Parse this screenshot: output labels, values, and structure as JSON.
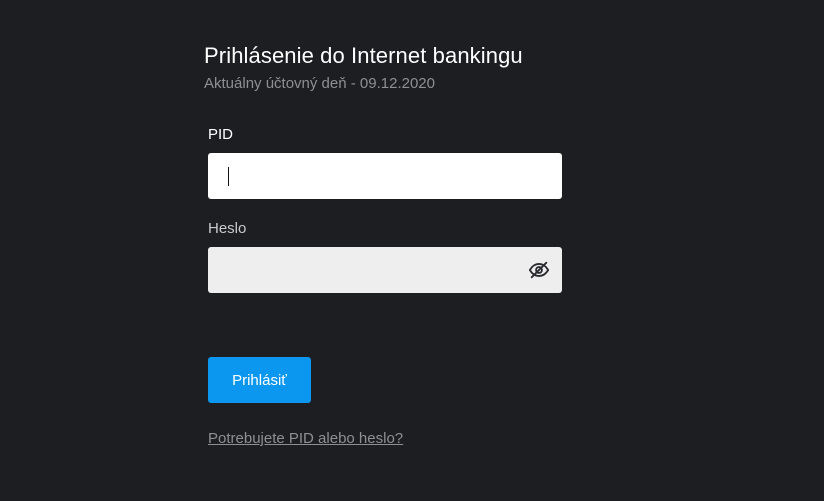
{
  "login": {
    "title": "Prihlásenie do Internet bankingu",
    "subtitle": "Aktuálny účtovný deň - 09.12.2020",
    "pid_label": "PID",
    "pid_value": "",
    "pid_placeholder": "",
    "password_label": "Heslo",
    "password_value": "",
    "password_toggle_icon": "eye-off-icon",
    "submit_label": "Prihlásiť",
    "help_link": "Potrebujete PID alebo heslo?"
  },
  "colors": {
    "background": "#1d1e22",
    "accent": "#0b97f0",
    "muted_text": "#8e8f94"
  }
}
